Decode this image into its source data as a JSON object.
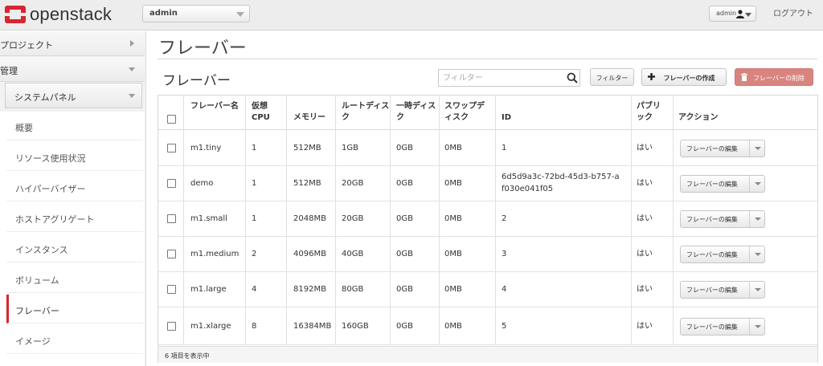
{
  "brand": {
    "logo_text": "openstack",
    "accent": "#d7262e"
  },
  "topbar": {
    "project_select": "admin",
    "user_menu": "admin",
    "logout": "ログアウト"
  },
  "sidebar": {
    "sections": [
      {
        "label": "プロジェクト",
        "expanded": false
      },
      {
        "label": "管理",
        "expanded": true
      }
    ],
    "sub_panel": "システムパネル",
    "items": [
      {
        "label": "概要",
        "active": false
      },
      {
        "label": "リソース使用状況",
        "active": false
      },
      {
        "label": "ハイパーバイザー",
        "active": false
      },
      {
        "label": "ホストアグリゲート",
        "active": false
      },
      {
        "label": "インスタンス",
        "active": false
      },
      {
        "label": "ボリューム",
        "active": false
      },
      {
        "label": "フレーバー",
        "active": true
      },
      {
        "label": "イメージ",
        "active": false
      }
    ]
  },
  "main": {
    "page_title": "フレーバー",
    "table_title": "フレーバー",
    "filter_placeholder": "フィルター",
    "filter_button": "フィルター",
    "create_button": "フレーバーの作成",
    "delete_button": "フレーバーの削除"
  },
  "table": {
    "columns": [
      "フレーバー名",
      "仮想 CPU",
      "メモリー",
      "ルートディスク",
      "一時ディスク",
      "スワップディスク",
      "ID",
      "パブリック",
      "アクション"
    ],
    "rows": [
      {
        "name": "m1.tiny",
        "vcpu": "1",
        "memory": "512MB",
        "root": "1GB",
        "ephemeral": "0GB",
        "swap": "0MB",
        "id": "1",
        "public": "はい",
        "action": "フレーバーの編集"
      },
      {
        "name": "demo",
        "vcpu": "1",
        "memory": "512MB",
        "root": "20GB",
        "ephemeral": "0GB",
        "swap": "0MB",
        "id": "6d5d9a3c-72bd-45d3-b757-af030e041f05",
        "public": "はい",
        "action": "フレーバーの編集"
      },
      {
        "name": "m1.small",
        "vcpu": "1",
        "memory": "2048MB",
        "root": "20GB",
        "ephemeral": "0GB",
        "swap": "0MB",
        "id": "2",
        "public": "はい",
        "action": "フレーバーの編集"
      },
      {
        "name": "m1.medium",
        "vcpu": "2",
        "memory": "4096MB",
        "root": "40GB",
        "ephemeral": "0GB",
        "swap": "0MB",
        "id": "3",
        "public": "はい",
        "action": "フレーバーの編集"
      },
      {
        "name": "m1.large",
        "vcpu": "4",
        "memory": "8192MB",
        "root": "80GB",
        "ephemeral": "0GB",
        "swap": "0MB",
        "id": "4",
        "public": "はい",
        "action": "フレーバーの編集"
      },
      {
        "name": "m1.xlarge",
        "vcpu": "8",
        "memory": "16384MB",
        "root": "160GB",
        "ephemeral": "0GB",
        "swap": "0MB",
        "id": "5",
        "public": "はい",
        "action": "フレーバーの編集"
      }
    ],
    "footer": "6 項目を表示中"
  }
}
